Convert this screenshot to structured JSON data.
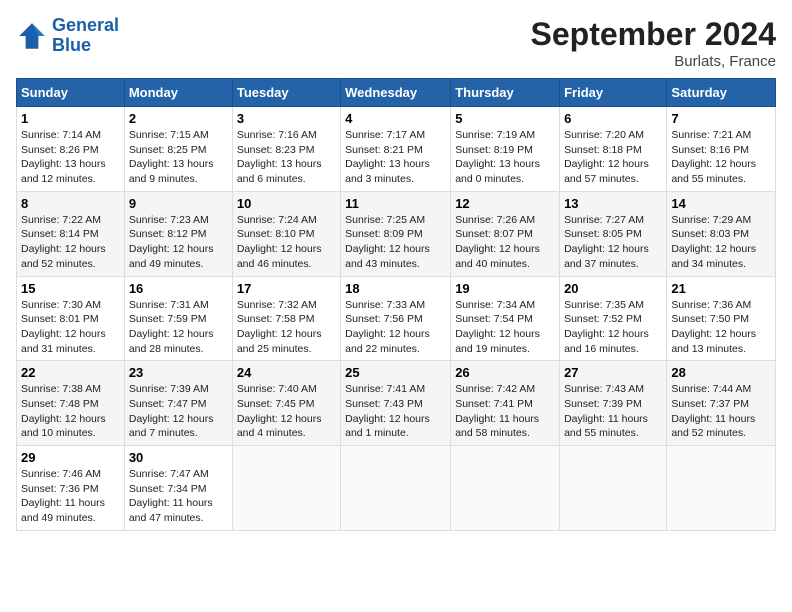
{
  "header": {
    "logo_line1": "General",
    "logo_line2": "Blue",
    "month": "September 2024",
    "location": "Burlats, France"
  },
  "days_of_week": [
    "Sunday",
    "Monday",
    "Tuesday",
    "Wednesday",
    "Thursday",
    "Friday",
    "Saturday"
  ],
  "weeks": [
    [
      {
        "day": "1",
        "text": "Sunrise: 7:14 AM\nSunset: 8:26 PM\nDaylight: 13 hours and 12 minutes."
      },
      {
        "day": "2",
        "text": "Sunrise: 7:15 AM\nSunset: 8:25 PM\nDaylight: 13 hours and 9 minutes."
      },
      {
        "day": "3",
        "text": "Sunrise: 7:16 AM\nSunset: 8:23 PM\nDaylight: 13 hours and 6 minutes."
      },
      {
        "day": "4",
        "text": "Sunrise: 7:17 AM\nSunset: 8:21 PM\nDaylight: 13 hours and 3 minutes."
      },
      {
        "day": "5",
        "text": "Sunrise: 7:19 AM\nSunset: 8:19 PM\nDaylight: 13 hours and 0 minutes."
      },
      {
        "day": "6",
        "text": "Sunrise: 7:20 AM\nSunset: 8:18 PM\nDaylight: 12 hours and 57 minutes."
      },
      {
        "day": "7",
        "text": "Sunrise: 7:21 AM\nSunset: 8:16 PM\nDaylight: 12 hours and 55 minutes."
      }
    ],
    [
      {
        "day": "8",
        "text": "Sunrise: 7:22 AM\nSunset: 8:14 PM\nDaylight: 12 hours and 52 minutes."
      },
      {
        "day": "9",
        "text": "Sunrise: 7:23 AM\nSunset: 8:12 PM\nDaylight: 12 hours and 49 minutes."
      },
      {
        "day": "10",
        "text": "Sunrise: 7:24 AM\nSunset: 8:10 PM\nDaylight: 12 hours and 46 minutes."
      },
      {
        "day": "11",
        "text": "Sunrise: 7:25 AM\nSunset: 8:09 PM\nDaylight: 12 hours and 43 minutes."
      },
      {
        "day": "12",
        "text": "Sunrise: 7:26 AM\nSunset: 8:07 PM\nDaylight: 12 hours and 40 minutes."
      },
      {
        "day": "13",
        "text": "Sunrise: 7:27 AM\nSunset: 8:05 PM\nDaylight: 12 hours and 37 minutes."
      },
      {
        "day": "14",
        "text": "Sunrise: 7:29 AM\nSunset: 8:03 PM\nDaylight: 12 hours and 34 minutes."
      }
    ],
    [
      {
        "day": "15",
        "text": "Sunrise: 7:30 AM\nSunset: 8:01 PM\nDaylight: 12 hours and 31 minutes."
      },
      {
        "day": "16",
        "text": "Sunrise: 7:31 AM\nSunset: 7:59 PM\nDaylight: 12 hours and 28 minutes."
      },
      {
        "day": "17",
        "text": "Sunrise: 7:32 AM\nSunset: 7:58 PM\nDaylight: 12 hours and 25 minutes."
      },
      {
        "day": "18",
        "text": "Sunrise: 7:33 AM\nSunset: 7:56 PM\nDaylight: 12 hours and 22 minutes."
      },
      {
        "day": "19",
        "text": "Sunrise: 7:34 AM\nSunset: 7:54 PM\nDaylight: 12 hours and 19 minutes."
      },
      {
        "day": "20",
        "text": "Sunrise: 7:35 AM\nSunset: 7:52 PM\nDaylight: 12 hours and 16 minutes."
      },
      {
        "day": "21",
        "text": "Sunrise: 7:36 AM\nSunset: 7:50 PM\nDaylight: 12 hours and 13 minutes."
      }
    ],
    [
      {
        "day": "22",
        "text": "Sunrise: 7:38 AM\nSunset: 7:48 PM\nDaylight: 12 hours and 10 minutes."
      },
      {
        "day": "23",
        "text": "Sunrise: 7:39 AM\nSunset: 7:47 PM\nDaylight: 12 hours and 7 minutes."
      },
      {
        "day": "24",
        "text": "Sunrise: 7:40 AM\nSunset: 7:45 PM\nDaylight: 12 hours and 4 minutes."
      },
      {
        "day": "25",
        "text": "Sunrise: 7:41 AM\nSunset: 7:43 PM\nDaylight: 12 hours and 1 minute."
      },
      {
        "day": "26",
        "text": "Sunrise: 7:42 AM\nSunset: 7:41 PM\nDaylight: 11 hours and 58 minutes."
      },
      {
        "day": "27",
        "text": "Sunrise: 7:43 AM\nSunset: 7:39 PM\nDaylight: 11 hours and 55 minutes."
      },
      {
        "day": "28",
        "text": "Sunrise: 7:44 AM\nSunset: 7:37 PM\nDaylight: 11 hours and 52 minutes."
      }
    ],
    [
      {
        "day": "29",
        "text": "Sunrise: 7:46 AM\nSunset: 7:36 PM\nDaylight: 11 hours and 49 minutes."
      },
      {
        "day": "30",
        "text": "Sunrise: 7:47 AM\nSunset: 7:34 PM\nDaylight: 11 hours and 47 minutes."
      },
      {
        "day": "",
        "text": ""
      },
      {
        "day": "",
        "text": ""
      },
      {
        "day": "",
        "text": ""
      },
      {
        "day": "",
        "text": ""
      },
      {
        "day": "",
        "text": ""
      }
    ]
  ]
}
